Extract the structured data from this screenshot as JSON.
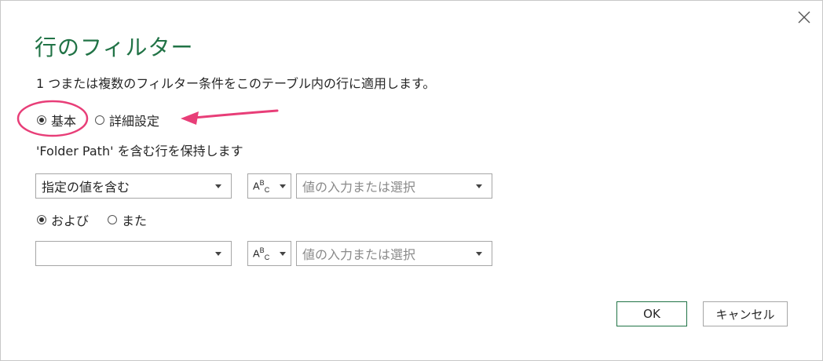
{
  "dialog": {
    "title": "行のフィルター",
    "description": "1 つまたは複数のフィルター条件をこのテーブル内の行に適用します。",
    "mode": {
      "basic_label": "基本",
      "advanced_label": "詳細設定",
      "selected": "basic"
    },
    "keep_rows_label": "'Folder Path' を含む行を保持します",
    "rule1": {
      "operator_value": "指定の値を含む",
      "type_icon": "ABC",
      "value_placeholder": "値の入力または選択"
    },
    "logic": {
      "and_label": "および",
      "or_label": "また",
      "selected": "and"
    },
    "rule2": {
      "operator_value": "",
      "type_icon": "ABC",
      "value_placeholder": "値の入力または選択"
    },
    "buttons": {
      "ok": "OK",
      "cancel": "キャンセル"
    },
    "icons": {
      "close": "close-icon",
      "annotation_circle": "highlight-ellipse",
      "annotation_arrow": "pointer-arrow"
    },
    "colors": {
      "title": "#217346",
      "ok_border": "#217346",
      "annotation": "#e83e78"
    }
  }
}
